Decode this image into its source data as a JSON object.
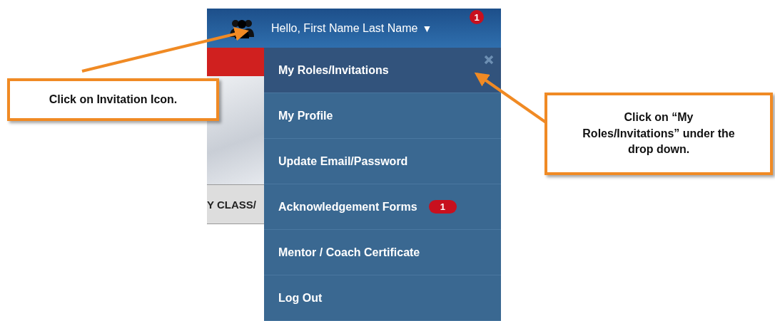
{
  "header": {
    "greeting": "Hello, First Name Last Name",
    "caret": "▼",
    "notification_count": "1"
  },
  "page_behind": {
    "tab_text": "Y CLASS/"
  },
  "dropdown": {
    "items": [
      {
        "label": "My Roles/Invitations",
        "selected": true
      },
      {
        "label": "My Profile",
        "selected": false
      },
      {
        "label": "Update Email/Password",
        "selected": false
      },
      {
        "label": "Acknowledgement Forms",
        "selected": false,
        "badge": "1"
      },
      {
        "label": "Mentor / Coach Certificate",
        "selected": false
      },
      {
        "label": "Log Out",
        "selected": false
      }
    ]
  },
  "callouts": [
    {
      "kind": "left",
      "text": "Click on Invitation Icon."
    },
    {
      "kind": "right",
      "text": "Click on “My Roles/Invitations” under the drop down."
    }
  ]
}
